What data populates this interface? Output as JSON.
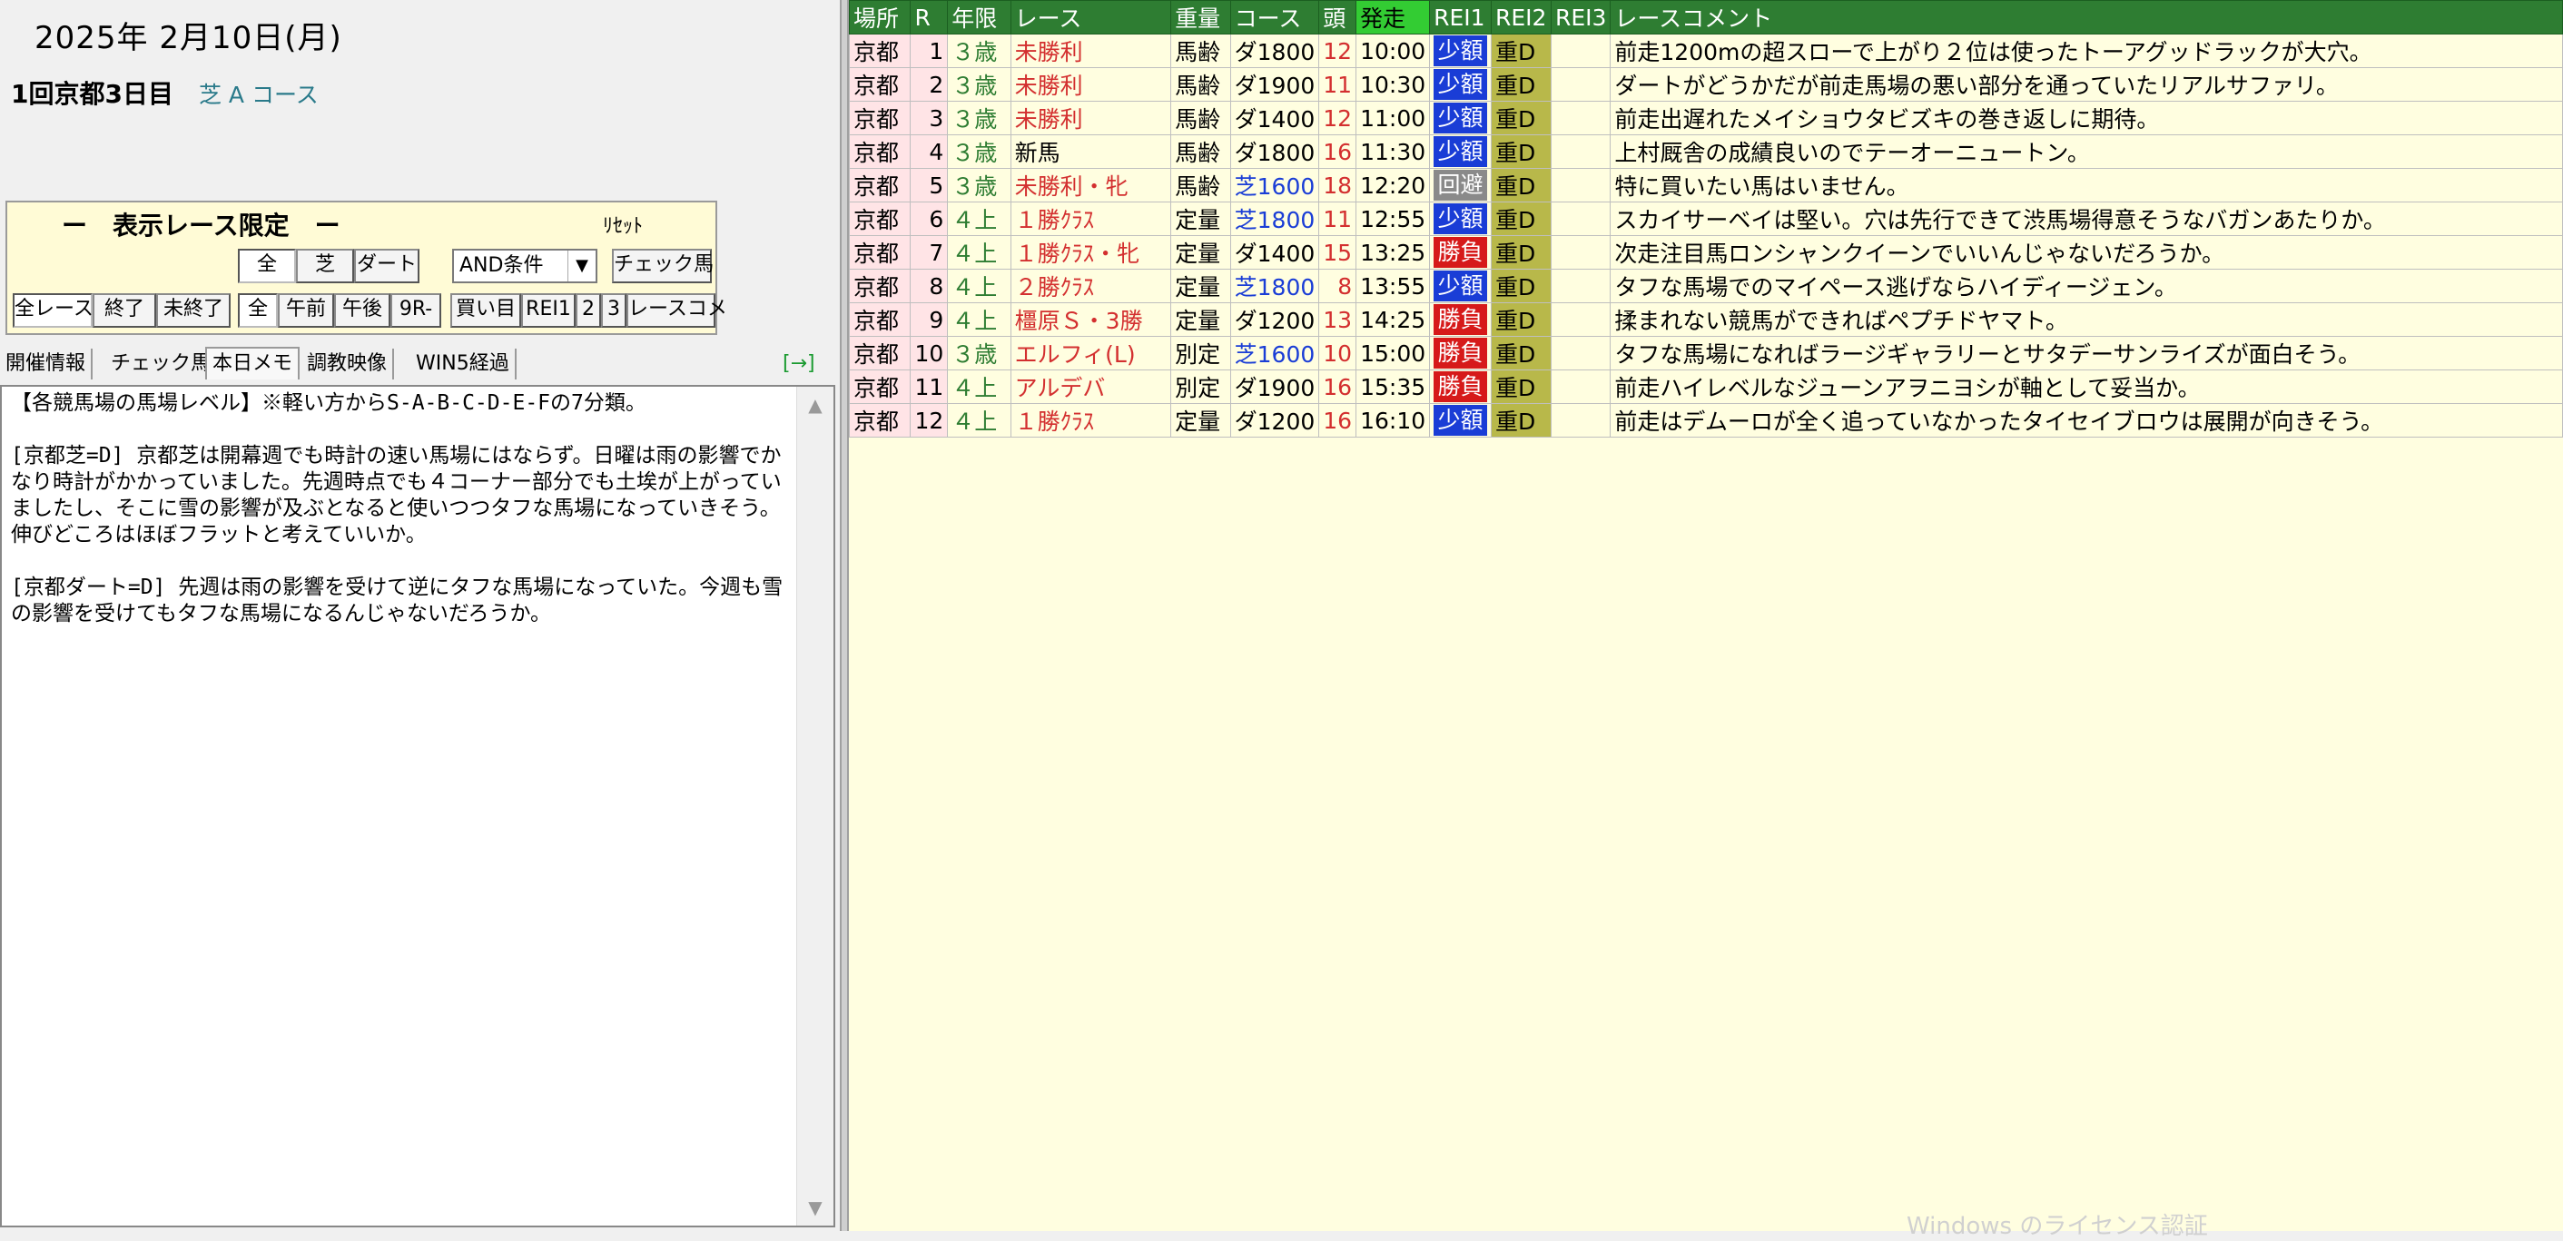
{
  "header": {
    "date": "2025年 2月10日(月)",
    "meeting": "1回京都3日目",
    "course": "芝 A コース"
  },
  "filter": {
    "title": "ー　表示レース限定　ー",
    "reset_label": "ﾘｾｯﾄ",
    "surface_buttons": [
      "全",
      "芝",
      "ダート"
    ],
    "condition_select": "AND条件",
    "check_horse_button": "チェック馬",
    "row3_buttons": [
      "全レース",
      "終了",
      "未終了",
      "全",
      "午前",
      "午後",
      "9R-",
      "買い目",
      "REI1",
      "2",
      "3",
      "レースコメ"
    ]
  },
  "tabs": [
    "開催情報",
    "チェック馬",
    "本日メモ",
    "調教映像",
    "WIN5経過"
  ],
  "tab_arrow": "[→]",
  "memo": {
    "text": "【各競馬場の馬場レベル】※軽い方からS-A-B-C-D-E-Fの7分類。\n\n[京都芝=D] 京都芝は開幕週でも時計の速い馬場にはならず。日曜は雨の影響でかなり時計がかかっていました。先週時点でも４コーナー部分でも土埃が上がっていましたし、そこに雪の影響が及ぶとなると使いつつタフな馬場になっていきそう。伸びどころはほぼフラットと考えていいか。\n\n[京都ダート=D] 先週は雨の影響を受けて逆にタフな馬場になっていた。今週も雪の影響を受けてもタフな馬場になるんじゃないだろうか。"
  },
  "grid": {
    "headers": [
      "場所",
      "R",
      "年限",
      "レース",
      "重量",
      "コース",
      "頭",
      "発走",
      "REI1",
      "REI2",
      "REI3",
      "レースコメント"
    ],
    "rows": [
      {
        "place": "京都",
        "r": "1",
        "age": "３歳",
        "race": "未勝利",
        "weight": "馬齢",
        "course": "ダ1800",
        "turf": false,
        "heads": "12",
        "start": "10:00",
        "kind": "少額",
        "ground": "重D",
        "comment": "前走1200mの超スローで上がり２位は使ったトーアグッドラックが大穴。"
      },
      {
        "place": "京都",
        "r": "2",
        "age": "３歳",
        "race": "未勝利",
        "weight": "馬齢",
        "course": "ダ1900",
        "turf": false,
        "heads": "11",
        "start": "10:30",
        "kind": "少額",
        "ground": "重D",
        "comment": "ダートがどうかだが前走馬場の悪い部分を通っていたリアルサファリ。"
      },
      {
        "place": "京都",
        "r": "3",
        "age": "３歳",
        "race": "未勝利",
        "weight": "馬齢",
        "course": "ダ1400",
        "turf": false,
        "heads": "12",
        "start": "11:00",
        "kind": "少額",
        "ground": "重D",
        "comment": "前走出遅れたメイショウタビズキの巻き返しに期待。"
      },
      {
        "place": "京都",
        "r": "4",
        "age": "３歳",
        "race": "新馬",
        "weight": "馬齢",
        "course": "ダ1800",
        "turf": false,
        "heads": "16",
        "start": "11:30",
        "kind": "少額",
        "ground": "重D",
        "comment": "上村厩舎の成績良いのでテーオーニュートン。",
        "plain": true
      },
      {
        "place": "京都",
        "r": "5",
        "age": "３歳",
        "race": "未勝利・牝",
        "weight": "馬齢",
        "course": "芝1600",
        "turf": true,
        "heads": "18",
        "start": "12:20",
        "kind": "回避",
        "ground": "重D",
        "comment": "特に買いたい馬はいません。"
      },
      {
        "place": "京都",
        "r": "6",
        "age": "４上",
        "race": "１勝ｸﾗｽ",
        "weight": "定量",
        "course": "芝1800",
        "turf": true,
        "heads": "11",
        "start": "12:55",
        "kind": "少額",
        "ground": "重D",
        "comment": "スカイサーベイは堅い。穴は先行できて渋馬場得意そうなバガンあたりか。"
      },
      {
        "place": "京都",
        "r": "7",
        "age": "４上",
        "race": "１勝ｸﾗｽ・牝",
        "weight": "定量",
        "course": "ダ1400",
        "turf": false,
        "heads": "15",
        "start": "13:25",
        "kind": "勝負",
        "ground": "重D",
        "comment": "次走注目馬ロンシャンクイーンでいいんじゃないだろうか。"
      },
      {
        "place": "京都",
        "r": "8",
        "age": "４上",
        "race": "２勝ｸﾗｽ",
        "weight": "定量",
        "course": "芝1800",
        "turf": true,
        "heads": "8",
        "start": "13:55",
        "kind": "少額",
        "ground": "重D",
        "comment": "タフな馬場でのマイペース逃げならハイディージェン。"
      },
      {
        "place": "京都",
        "r": "9",
        "age": "４上",
        "race": "橿原Ｓ・3勝",
        "weight": "定量",
        "course": "ダ1200",
        "turf": false,
        "heads": "13",
        "start": "14:25",
        "kind": "勝負",
        "ground": "重D",
        "comment": "揉まれない競馬ができればペプチドヤマト。"
      },
      {
        "place": "京都",
        "r": "10",
        "age": "３歳",
        "race": "エルフィ(L)",
        "weight": "別定",
        "course": "芝1600",
        "turf": true,
        "heads": "10",
        "start": "15:00",
        "kind": "勝負",
        "ground": "重D",
        "comment": "タフな馬場になればラージギャラリーとサタデーサンライズが面白そう。"
      },
      {
        "place": "京都",
        "r": "11",
        "age": "４上",
        "race": "アルデバ",
        "weight": "別定",
        "course": "ダ1900",
        "turf": false,
        "heads": "16",
        "start": "15:35",
        "kind": "勝負",
        "ground": "重D",
        "comment": "前走ハイレベルなジューンアヲニヨシが軸として妥当か。"
      },
      {
        "place": "京都",
        "r": "12",
        "age": "４上",
        "race": "１勝ｸﾗｽ",
        "weight": "定量",
        "course": "ダ1200",
        "turf": false,
        "heads": "16",
        "start": "16:10",
        "kind": "少額",
        "ground": "重D",
        "comment": "前走はデムーロが全く追っていなかったタイセイブロウは展開が向きそう。"
      }
    ]
  },
  "watermark": "Windows のライセンス認証",
  "colors": {
    "header_green": "#2e7d32",
    "start_header": "#33cc33",
    "small_bet": "#1a3dd6",
    "big_bet": "#d61a1a",
    "avoid": "#8a8a8a",
    "ground": "#b8b84a",
    "grid_bg": "#fffee0",
    "place_bg": "#ffe4e6"
  }
}
